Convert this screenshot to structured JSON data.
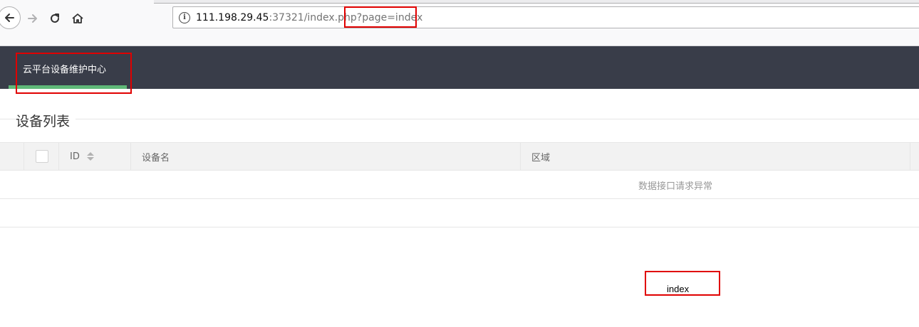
{
  "browser": {
    "url_host": "111.198.29.45",
    "url_rest": ":37321/index.php?page=index",
    "info_icon": "i"
  },
  "header": {
    "nav_title": "云平台设备维护中心"
  },
  "page": {
    "title": "设备列表"
  },
  "table": {
    "columns": [
      "ID",
      "设备名",
      "区域"
    ],
    "empty_message": "数据接口请求异常"
  },
  "footer": {
    "index_text": "index"
  },
  "colors": {
    "header_bg": "#393d49",
    "tab_underline": "#5fb878",
    "annotation": "#e00000"
  }
}
